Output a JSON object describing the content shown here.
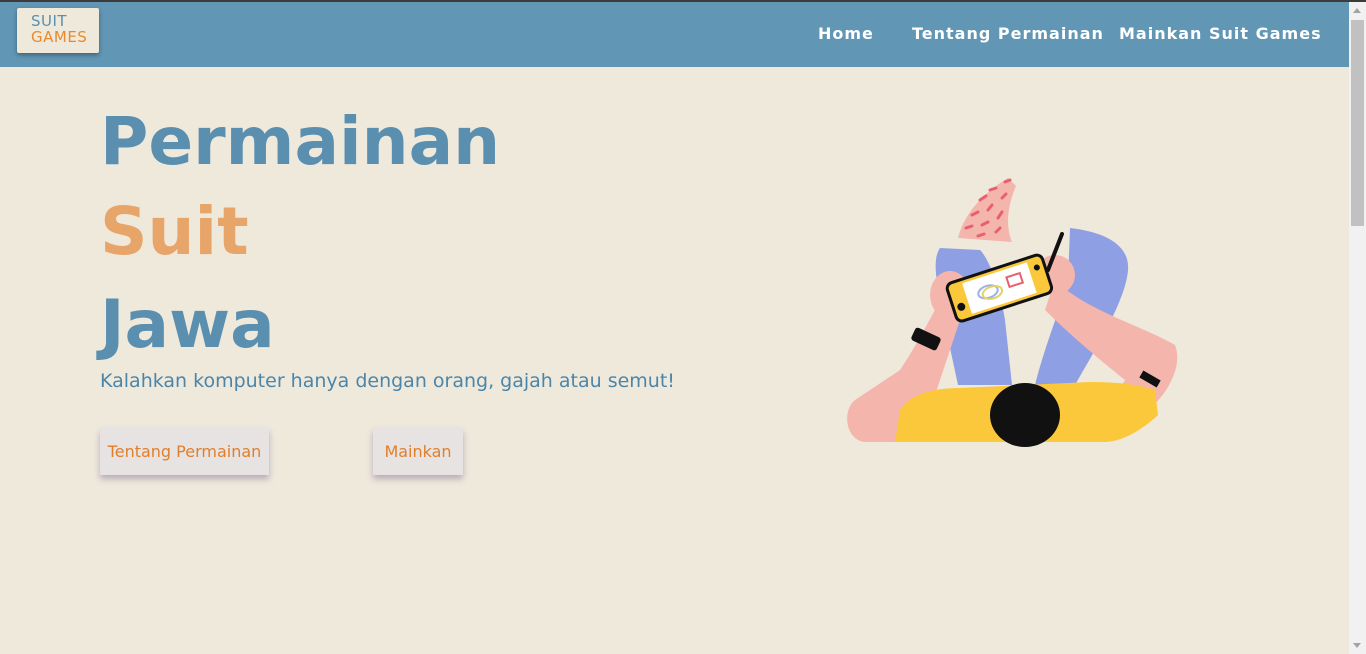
{
  "brand": {
    "logo_line1": "SUIT",
    "logo_line2": "GAMES",
    "primary_color": "#6196b4",
    "accent_color": "#e88a2d",
    "background_color": "#efe9dc"
  },
  "nav": {
    "items": [
      {
        "label": "Home"
      },
      {
        "label": "Tentang Permainan"
      },
      {
        "label": "Mainkan Suit Games"
      }
    ]
  },
  "hero": {
    "title_line1": "Permainan",
    "title_line2": "Suit",
    "title_line3": "Jawa",
    "subtitle": "Kalahkan komputer hanya dengan orang, gajah atau semut!",
    "buttons": [
      {
        "label": "Tentang Permainan"
      },
      {
        "label": "Mainkan"
      }
    ],
    "illustration_icon": "person-playing-handheld-game-illustration"
  }
}
